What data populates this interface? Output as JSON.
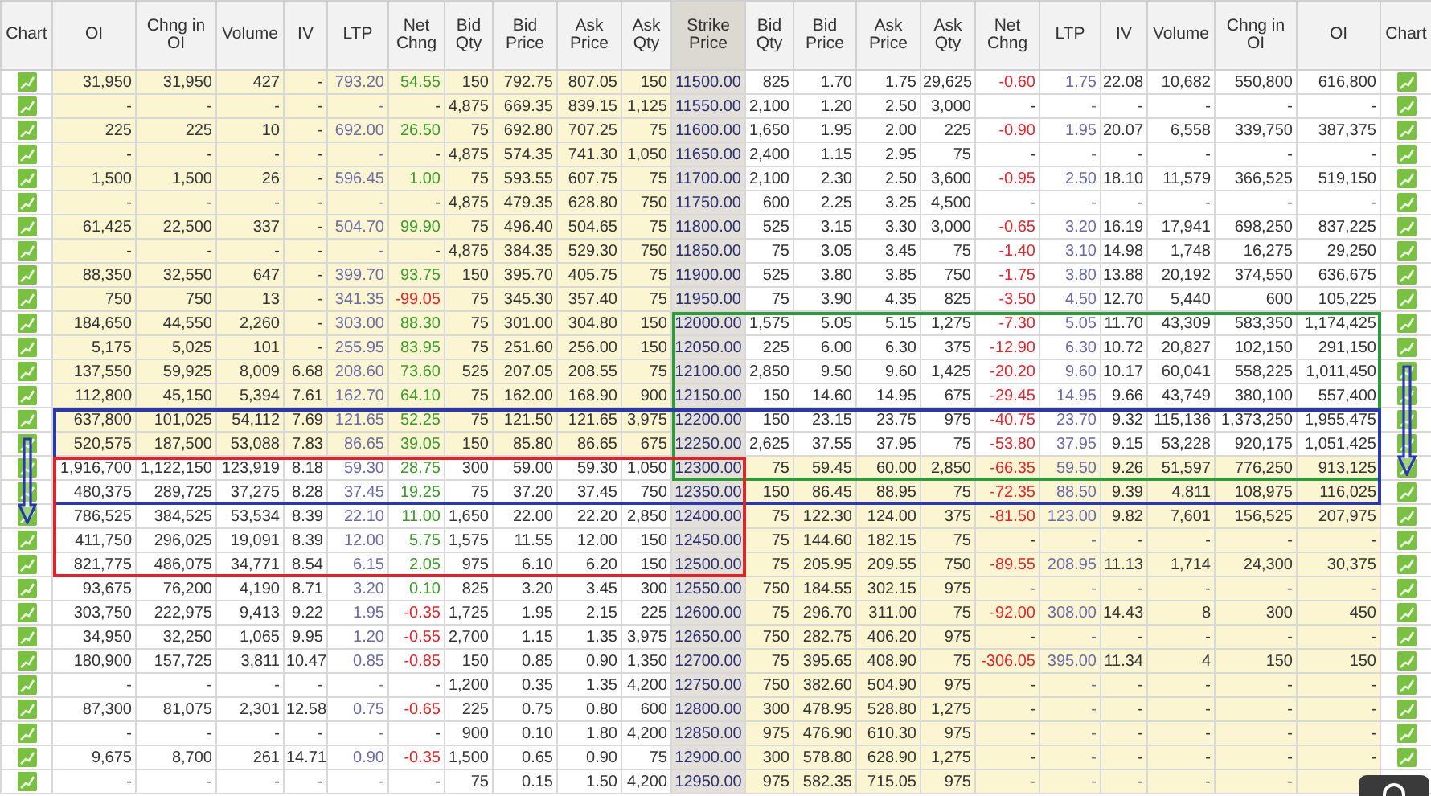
{
  "columns": [
    "Chart",
    "OI",
    "Chng in OI",
    "Volume",
    "IV",
    "LTP",
    "Net Chng",
    "Bid Qty",
    "Bid Price",
    "Ask Price",
    "Ask Qty",
    "Strike Price",
    "Bid Qty",
    "Bid Price",
    "Ask Price",
    "Ask Qty",
    "Net Chng",
    "LTP",
    "IV",
    "Volume",
    "Chng in OI",
    "OI",
    "Chart"
  ],
  "rows": [
    {
      "strike": "11500.00",
      "call_itm": true,
      "put_itm": false,
      "chart_right": true,
      "call_negative": false,
      "put_negative": true,
      "call": [
        "31,950",
        "31,950",
        "427",
        "-",
        "793.20",
        "54.55",
        "150",
        "792.75",
        "807.05",
        "150"
      ],
      "put": [
        "825",
        "1.70",
        "1.75",
        "29,625",
        "-0.60",
        "1.75",
        "22.08",
        "10,682",
        "550,800",
        "616,800"
      ]
    },
    {
      "strike": "11550.00",
      "call_itm": true,
      "put_itm": false,
      "chart_right": true,
      "call": [
        "-",
        "-",
        "-",
        "-",
        "-",
        "-",
        "4,875",
        "669.35",
        "839.15",
        "1,125"
      ],
      "put": [
        "2,100",
        "1.20",
        "2.50",
        "3,000",
        "-",
        "-",
        "-",
        "-",
        "-",
        "-"
      ]
    },
    {
      "strike": "11600.00",
      "call_itm": true,
      "put_itm": false,
      "chart_right": true,
      "call_negative": false,
      "put_negative": true,
      "call": [
        "225",
        "225",
        "10",
        "-",
        "692.00",
        "26.50",
        "75",
        "692.80",
        "707.25",
        "75"
      ],
      "put": [
        "1,650",
        "1.95",
        "2.00",
        "225",
        "-0.90",
        "1.95",
        "20.07",
        "6,558",
        "339,750",
        "387,375"
      ]
    },
    {
      "strike": "11650.00",
      "call_itm": true,
      "put_itm": false,
      "chart_right": true,
      "call": [
        "-",
        "-",
        "-",
        "-",
        "-",
        "-",
        "4,875",
        "574.35",
        "741.30",
        "1,050"
      ],
      "put": [
        "2,400",
        "1.15",
        "2.95",
        "75",
        "-",
        "-",
        "-",
        "-",
        "-",
        "-"
      ]
    },
    {
      "strike": "11700.00",
      "call_itm": true,
      "put_itm": false,
      "chart_right": true,
      "call_negative": false,
      "put_negative": true,
      "call": [
        "1,500",
        "1,500",
        "26",
        "-",
        "596.45",
        "1.00",
        "75",
        "593.55",
        "607.75",
        "75"
      ],
      "put": [
        "2,100",
        "2.30",
        "2.50",
        "3,600",
        "-0.95",
        "2.50",
        "18.10",
        "11,579",
        "366,525",
        "519,150"
      ]
    },
    {
      "strike": "11750.00",
      "call_itm": true,
      "put_itm": false,
      "chart_right": true,
      "call": [
        "-",
        "-",
        "-",
        "-",
        "-",
        "-",
        "4,875",
        "479.35",
        "628.80",
        "750"
      ],
      "put": [
        "600",
        "2.25",
        "3.25",
        "4,500",
        "-",
        "-",
        "-",
        "-",
        "-",
        "-"
      ]
    },
    {
      "strike": "11800.00",
      "call_itm": true,
      "put_itm": false,
      "chart_right": true,
      "call_negative": false,
      "put_negative": true,
      "call": [
        "61,425",
        "22,500",
        "337",
        "-",
        "504.70",
        "99.90",
        "75",
        "496.40",
        "504.65",
        "75"
      ],
      "put": [
        "525",
        "3.15",
        "3.30",
        "3,000",
        "-0.65",
        "3.20",
        "16.19",
        "17,941",
        "698,250",
        "837,225"
      ]
    },
    {
      "strike": "11850.00",
      "call_itm": true,
      "put_itm": false,
      "chart_right": true,
      "put_negative": true,
      "call": [
        "-",
        "-",
        "-",
        "-",
        "-",
        "-",
        "4,875",
        "384.35",
        "529.30",
        "750"
      ],
      "put": [
        "75",
        "3.05",
        "3.45",
        "75",
        "-1.40",
        "3.10",
        "14.98",
        "1,748",
        "16,275",
        "29,250"
      ]
    },
    {
      "strike": "11900.00",
      "call_itm": true,
      "put_itm": false,
      "chart_right": true,
      "call_negative": false,
      "put_negative": true,
      "call": [
        "88,350",
        "32,550",
        "647",
        "-",
        "399.70",
        "93.75",
        "150",
        "395.70",
        "405.75",
        "75"
      ],
      "put": [
        "525",
        "3.80",
        "3.85",
        "750",
        "-1.75",
        "3.80",
        "13.88",
        "20,192",
        "374,550",
        "636,675"
      ]
    },
    {
      "strike": "11950.00",
      "call_itm": true,
      "put_itm": false,
      "chart_right": true,
      "call_negative": true,
      "put_negative": true,
      "call": [
        "750",
        "750",
        "13",
        "-",
        "341.35",
        "-99.05",
        "75",
        "345.30",
        "357.40",
        "75"
      ],
      "put": [
        "75",
        "3.90",
        "4.35",
        "825",
        "-3.50",
        "4.50",
        "12.70",
        "5,440",
        "600",
        "105,225"
      ]
    },
    {
      "strike": "12000.00",
      "call_itm": true,
      "put_itm": false,
      "chart_right": true,
      "call_negative": false,
      "put_negative": true,
      "call": [
        "184,650",
        "44,550",
        "2,260",
        "-",
        "303.00",
        "88.30",
        "75",
        "301.00",
        "304.80",
        "150"
      ],
      "put": [
        "1,575",
        "5.05",
        "5.15",
        "1,275",
        "-7.30",
        "5.05",
        "11.70",
        "43,309",
        "583,350",
        "1,174,425"
      ]
    },
    {
      "strike": "12050.00",
      "call_itm": true,
      "put_itm": false,
      "chart_right": true,
      "call_negative": false,
      "put_negative": true,
      "call": [
        "5,175",
        "5,025",
        "101",
        "-",
        "255.95",
        "83.95",
        "75",
        "251.60",
        "256.00",
        "150"
      ],
      "put": [
        "225",
        "6.00",
        "6.30",
        "375",
        "-12.90",
        "6.30",
        "10.72",
        "20,827",
        "102,150",
        "291,150"
      ]
    },
    {
      "strike": "12100.00",
      "call_itm": true,
      "put_itm": false,
      "chart_right": true,
      "call_negative": false,
      "put_negative": true,
      "call": [
        "137,550",
        "59,925",
        "8,009",
        "6.68",
        "208.60",
        "73.60",
        "525",
        "207.05",
        "208.55",
        "75"
      ],
      "put": [
        "2,850",
        "9.50",
        "9.60",
        "1,425",
        "-20.20",
        "9.60",
        "10.17",
        "60,041",
        "558,225",
        "1,011,450"
      ]
    },
    {
      "strike": "12150.00",
      "call_itm": true,
      "put_itm": false,
      "chart_right": true,
      "call_negative": false,
      "put_negative": true,
      "call": [
        "112,800",
        "45,150",
        "5,394",
        "7.61",
        "162.70",
        "64.10",
        "75",
        "162.00",
        "168.90",
        "900"
      ],
      "put": [
        "150",
        "14.60",
        "14.95",
        "675",
        "-29.45",
        "14.95",
        "9.66",
        "43,749",
        "380,100",
        "557,400"
      ]
    },
    {
      "strike": "12200.00",
      "call_itm": true,
      "put_itm": false,
      "chart_right": true,
      "call_negative": false,
      "put_negative": true,
      "call": [
        "637,800",
        "101,025",
        "54,112",
        "7.69",
        "121.65",
        "52.25",
        "75",
        "121.50",
        "121.65",
        "3,975"
      ],
      "put": [
        "150",
        "23.15",
        "23.75",
        "975",
        "-40.75",
        "23.70",
        "9.32",
        "115,136",
        "1,373,250",
        "1,955,475"
      ]
    },
    {
      "strike": "12250.00",
      "call_itm": true,
      "put_itm": false,
      "chart_right": true,
      "call_negative": false,
      "put_negative": true,
      "call": [
        "520,575",
        "187,500",
        "53,088",
        "7.83",
        "86.65",
        "39.05",
        "150",
        "85.80",
        "86.65",
        "675"
      ],
      "put": [
        "2,625",
        "37.55",
        "37.95",
        "75",
        "-53.80",
        "37.95",
        "9.15",
        "53,228",
        "920,175",
        "1,051,425"
      ]
    },
    {
      "strike": "12300.00",
      "call_itm": false,
      "put_itm": true,
      "chart_right": true,
      "call_negative": false,
      "put_negative": true,
      "call": [
        "1,916,700",
        "1,122,150",
        "123,919",
        "8.18",
        "59.30",
        "28.75",
        "300",
        "59.00",
        "59.30",
        "1,050"
      ],
      "put": [
        "75",
        "59.45",
        "60.00",
        "2,850",
        "-66.35",
        "59.50",
        "9.26",
        "51,597",
        "776,250",
        "913,125"
      ]
    },
    {
      "strike": "12350.00",
      "call_itm": false,
      "put_itm": true,
      "chart_right": true,
      "call_negative": false,
      "put_negative": true,
      "call": [
        "480,375",
        "289,725",
        "37,275",
        "8.28",
        "37.45",
        "19.25",
        "75",
        "37.20",
        "37.45",
        "750"
      ],
      "put": [
        "150",
        "86.45",
        "88.95",
        "75",
        "-72.35",
        "88.50",
        "9.39",
        "4,811",
        "108,975",
        "116,025"
      ]
    },
    {
      "strike": "12400.00",
      "call_itm": false,
      "put_itm": true,
      "chart_right": true,
      "call_negative": false,
      "put_negative": true,
      "call": [
        "786,525",
        "384,525",
        "53,534",
        "8.39",
        "22.10",
        "11.00",
        "1,650",
        "22.00",
        "22.20",
        "2,850"
      ],
      "put": [
        "75",
        "122.30",
        "124.00",
        "375",
        "-81.50",
        "123.00",
        "9.82",
        "7,601",
        "156,525",
        "207,975"
      ]
    },
    {
      "strike": "12450.00",
      "call_itm": false,
      "put_itm": true,
      "chart_right": true,
      "call_negative": false,
      "call": [
        "411,750",
        "296,025",
        "19,091",
        "8.39",
        "12.00",
        "5.75",
        "1,575",
        "11.55",
        "12.00",
        "150"
      ],
      "put": [
        "75",
        "144.60",
        "182.15",
        "75",
        "-",
        "-",
        "-",
        "-",
        "-",
        "-"
      ]
    },
    {
      "strike": "12500.00",
      "call_itm": false,
      "put_itm": true,
      "chart_right": true,
      "call_negative": false,
      "put_negative": true,
      "call": [
        "821,775",
        "486,075",
        "34,771",
        "8.54",
        "6.15",
        "2.05",
        "975",
        "6.10",
        "6.20",
        "150"
      ],
      "put": [
        "75",
        "205.95",
        "209.55",
        "750",
        "-89.55",
        "208.95",
        "11.13",
        "1,714",
        "24,300",
        "30,375"
      ]
    },
    {
      "strike": "12550.00",
      "call_itm": false,
      "put_itm": true,
      "chart_right": true,
      "call_negative": false,
      "call": [
        "93,675",
        "76,200",
        "4,190",
        "8.71",
        "3.20",
        "0.10",
        "825",
        "3.20",
        "3.45",
        "300"
      ],
      "put": [
        "750",
        "184.55",
        "302.15",
        "975",
        "-",
        "-",
        "-",
        "-",
        "-",
        "-"
      ]
    },
    {
      "strike": "12600.00",
      "call_itm": false,
      "put_itm": true,
      "chart_right": true,
      "call_negative": true,
      "put_negative": true,
      "call": [
        "303,750",
        "222,975",
        "9,413",
        "9.22",
        "1.95",
        "-0.35",
        "1,725",
        "1.95",
        "2.15",
        "225"
      ],
      "put": [
        "75",
        "296.70",
        "311.00",
        "75",
        "-92.00",
        "308.00",
        "14.43",
        "8",
        "300",
        "450"
      ]
    },
    {
      "strike": "12650.00",
      "call_itm": false,
      "put_itm": true,
      "chart_right": true,
      "call_negative": true,
      "call": [
        "34,950",
        "32,250",
        "1,065",
        "9.95",
        "1.20",
        "-0.55",
        "2,700",
        "1.15",
        "1.35",
        "3,975"
      ],
      "put": [
        "750",
        "282.75",
        "406.20",
        "975",
        "-",
        "-",
        "-",
        "-",
        "-",
        "-"
      ]
    },
    {
      "strike": "12700.00",
      "call_itm": false,
      "put_itm": true,
      "chart_right": true,
      "call_negative": true,
      "put_negative": true,
      "call": [
        "180,900",
        "157,725",
        "3,811",
        "10.47",
        "0.85",
        "-0.85",
        "150",
        "0.85",
        "0.90",
        "1,350"
      ],
      "put": [
        "75",
        "395.65",
        "408.90",
        "75",
        "-306.05",
        "395.00",
        "11.34",
        "4",
        "150",
        "150"
      ]
    },
    {
      "strike": "12750.00",
      "call_itm": false,
      "put_itm": true,
      "chart_right": true,
      "call": [
        "-",
        "-",
        "-",
        "-",
        "-",
        "-",
        "1,200",
        "0.35",
        "1.35",
        "4,200"
      ],
      "put": [
        "750",
        "382.60",
        "504.90",
        "975",
        "-",
        "-",
        "-",
        "-",
        "-",
        "-"
      ]
    },
    {
      "strike": "12800.00",
      "call_itm": false,
      "put_itm": true,
      "chart_right": true,
      "call_negative": true,
      "call": [
        "87,300",
        "81,075",
        "2,301",
        "12.58",
        "0.75",
        "-0.65",
        "225",
        "0.75",
        "0.80",
        "600"
      ],
      "put": [
        "300",
        "478.95",
        "528.80",
        "1,275",
        "-",
        "-",
        "-",
        "-",
        "-",
        "-"
      ]
    },
    {
      "strike": "12850.00",
      "call_itm": false,
      "put_itm": true,
      "chart_right": true,
      "call": [
        "-",
        "-",
        "-",
        "-",
        "-",
        "-",
        "900",
        "0.10",
        "1.80",
        "4,200"
      ],
      "put": [
        "975",
        "476.90",
        "610.30",
        "975",
        "-",
        "-",
        "-",
        "-",
        "-",
        "-"
      ]
    },
    {
      "strike": "12900.00",
      "call_itm": false,
      "put_itm": true,
      "chart_right": true,
      "call_negative": true,
      "call": [
        "9,675",
        "8,700",
        "261",
        "14.71",
        "0.90",
        "-0.35",
        "1,500",
        "0.65",
        "0.90",
        "75"
      ],
      "put": [
        "300",
        "578.80",
        "628.90",
        "1,275",
        "-",
        "-",
        "-",
        "-",
        "-",
        "-"
      ]
    },
    {
      "strike": "12950.00",
      "call_itm": false,
      "put_itm": true,
      "chart_right": false,
      "call": [
        "-",
        "-",
        "-",
        "-",
        "-",
        "-",
        "75",
        "0.15",
        "1.50",
        "4,200"
      ],
      "put": [
        "975",
        "582.35",
        "715.05",
        "975",
        "-",
        "-",
        "-",
        "-",
        "-"
      ]
    }
  ],
  "annotations": [
    {
      "kind": "box",
      "color": "#2e9a3c"
    },
    {
      "kind": "box",
      "color": "#2a38b0"
    },
    {
      "kind": "box",
      "color": "#d8262c"
    },
    {
      "kind": "arrow",
      "color": "#2a38b0"
    },
    {
      "kind": "arrow",
      "color": "#2a38b0"
    }
  ]
}
